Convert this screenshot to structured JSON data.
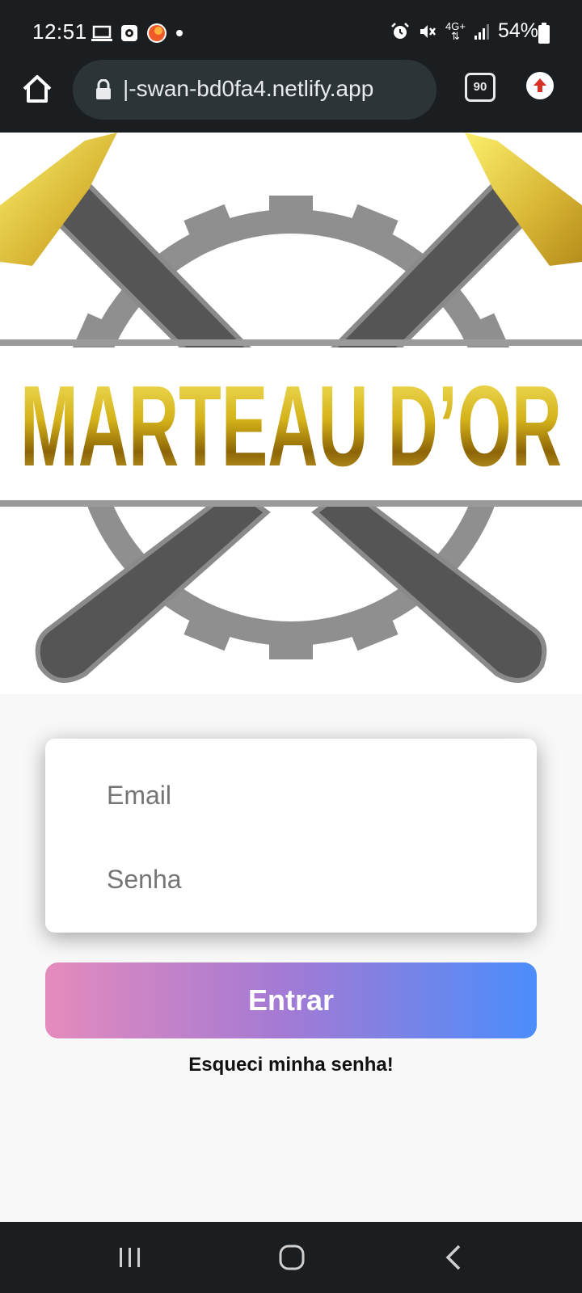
{
  "status_bar": {
    "time": "12:51",
    "battery_percent": "54%",
    "network_label": "4G+",
    "left_icons": [
      "laptop-icon",
      "screen-record-icon",
      "app-notification-icon",
      "dot-icon"
    ],
    "right_icons": [
      "alarm-icon",
      "mute-icon",
      "network-4g-icon",
      "signal-icon",
      "battery-icon"
    ]
  },
  "browser": {
    "url": "|-swan-bd0fa4.netlify.app",
    "tab_count": "90",
    "icons": [
      "home-icon",
      "lock-icon",
      "tabs-icon",
      "update-icon"
    ]
  },
  "hero": {
    "logo_text": "MARTEAU D’OR",
    "colors": {
      "gold_light": "#f3e25f",
      "gold_dark": "#a47b0c",
      "gear": "#8f8f8f",
      "handle": "#555555"
    }
  },
  "login": {
    "email_placeholder": "Email",
    "password_placeholder": "Senha",
    "submit_label": "Entrar",
    "forgot_label": "Esqueci minha senha!",
    "button_gradient": [
      "#e58bbd",
      "#a47ad4",
      "#4b8dfb"
    ]
  },
  "nav_bar": {
    "icons": [
      "recents-icon",
      "home-nav-icon",
      "back-icon"
    ]
  }
}
